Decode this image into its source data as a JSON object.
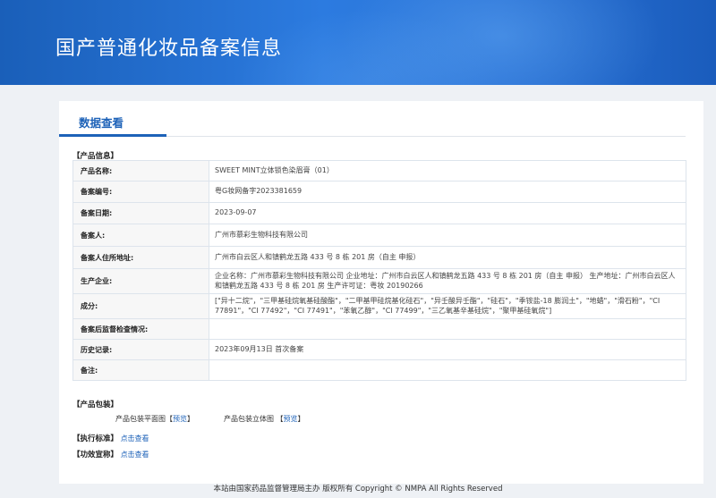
{
  "header": {
    "title": "国产普通化妆品备案信息"
  },
  "tabs": [
    {
      "label": "数据查看"
    }
  ],
  "product_info": {
    "section_title": "【产品信息】",
    "rows": [
      {
        "label": "产品名称:",
        "value": "SWEET MINT立体锁色染眉膏（01）"
      },
      {
        "label": "备案编号:",
        "value": "粤G妆网备字2023381659"
      },
      {
        "label": "备案日期:",
        "value": "2023-09-07"
      },
      {
        "label": "备案人:",
        "value": "广州市慕彩生物科技有限公司"
      },
      {
        "label": "备案人住所地址:",
        "value": "广州市白云区人和镇鹤龙五路 433 号 8 栋 201 房（自主 申报）"
      },
      {
        "label": "生产企业:",
        "value": "企业名称：广州市慕彩生物科技有限公司 企业地址：广州市白云区人和镇鹤龙五路 433 号 8 栋 201 房（自主 申报） 生产地址：广州市白云区人和镇鹤龙五路 433 号 8 栋 201 房 生产许可证：粤妆 20190266"
      },
      {
        "label": "成分:",
        "value": "[\"异十二烷\"，\"三甲基硅烷氧基硅酸酯\"，\"二甲基甲硅烷基化硅石\"，\"异壬酸异壬酯\"，\"硅石\"，\"季铵盐-18 膨润土\"，\"地蜡\"，\"滑石粉\"，\"CI 77891\"，\"CI 77492\"，\"CI 77491\"，\"苯氧乙醇\"，\"CI 77499\"，\"三乙氧基辛基硅烷\"，\"聚甲基硅氧烷\"]"
      },
      {
        "label": "备案后监督检查情况:",
        "value": ""
      },
      {
        "label": "历史记录:",
        "value": "2023年09月13日 首次备案"
      },
      {
        "label": "备注:",
        "value": ""
      }
    ]
  },
  "packaging": {
    "section_title": "【产品包装】",
    "flat_label": "产品包装平面图",
    "flat_link": "预览",
    "solid_label": "产品包装立体图",
    "solid_link": "预览",
    "bracket_open": "【",
    "bracket_close": "】"
  },
  "standard": {
    "section_title": "【执行标准】",
    "link": "点击查看"
  },
  "efficacy": {
    "section_title": "【功效宣称】",
    "link": "点击查看"
  },
  "footer": {
    "text": "本站由国家药品监督管理局主办 版权所有 Copyright © NMPA All Rights Reserved"
  }
}
